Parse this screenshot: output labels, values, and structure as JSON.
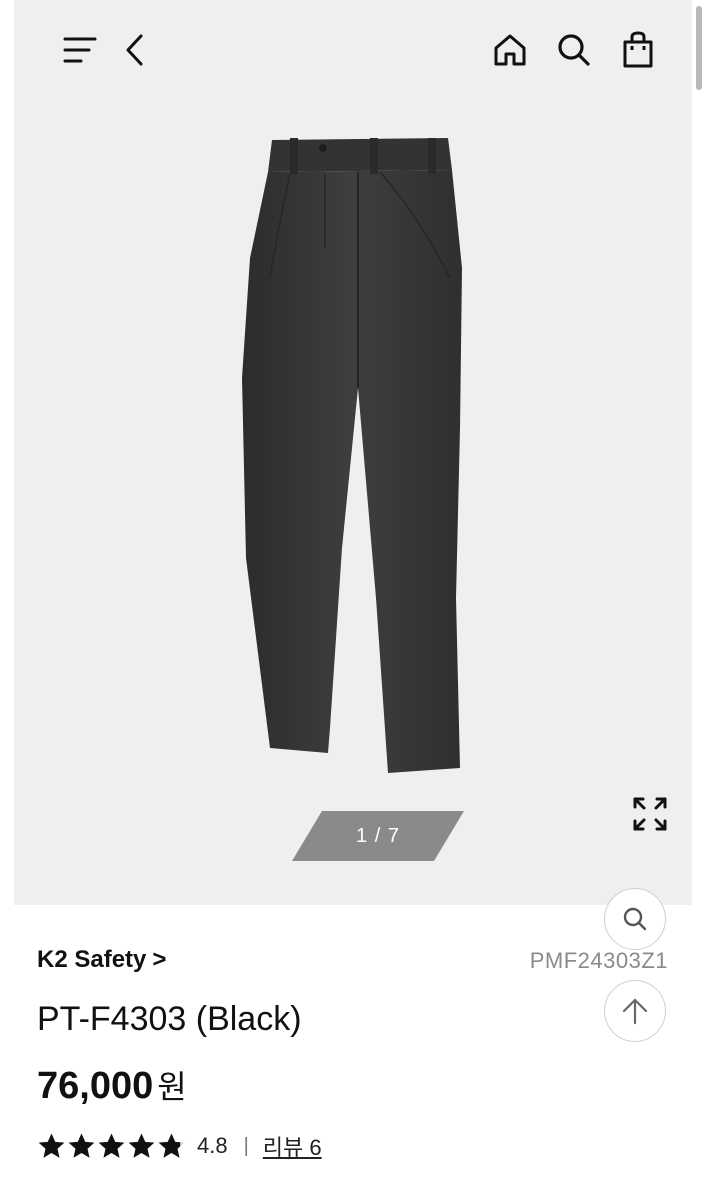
{
  "header": {
    "menu_icon": "menu-lines-icon",
    "back_icon": "chevron-left-icon",
    "home_icon": "home-icon",
    "search_icon": "search-icon",
    "bag_icon": "shopping-bag-icon"
  },
  "gallery": {
    "image_icon": "product-photo",
    "pager": "1 / 7",
    "current": 1,
    "total": 7,
    "expand_icon": "expand-arrows-icon"
  },
  "floating": {
    "search_icon": "search-icon",
    "top_icon": "arrow-up-icon"
  },
  "product": {
    "brand": "K2 Safety",
    "brand_chevron": ">",
    "code": "PMF24303Z1",
    "name": "PT-F4303 (Black)",
    "price": "76,000",
    "currency": "원",
    "rating": "4.8",
    "rating_value": 4.8,
    "rating_max": 5,
    "separator": "|",
    "review_label": "리뷰 6"
  },
  "colors": {
    "gallery_bg": "#efefef",
    "pager_bg": "#8a8a8a",
    "text": "#111111",
    "code_gray": "#8a8a8a"
  }
}
